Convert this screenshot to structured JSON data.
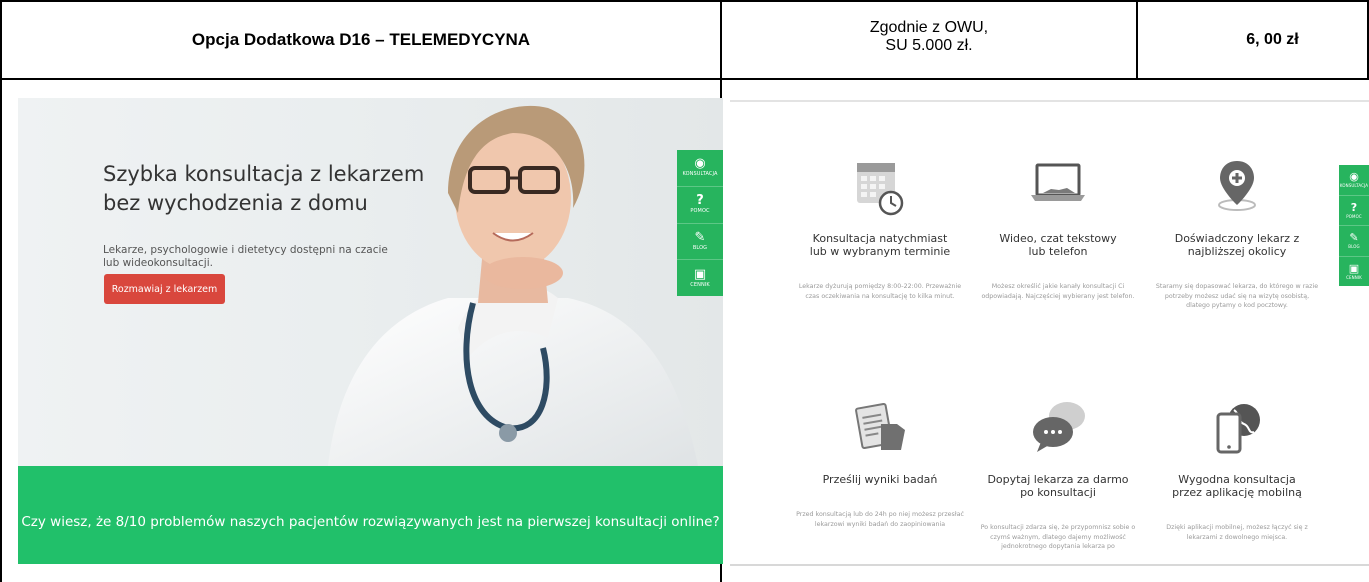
{
  "header": {
    "title": "Opcja Dodatkowa D16 – TELEMEDYCYNA",
    "terms_line1": "Zgodnie z OWU,",
    "terms_line2": "SU 5.000 zł.",
    "price": "6, 00 zł"
  },
  "left_screenshot": {
    "hero_title_line1": "Szybka konsultacja z lekarzem",
    "hero_title_line2": "bez wychodzenia z domu",
    "hero_subtitle_line1": "Lekarze, psychologowie i dietetycy dostępni na czacie",
    "hero_subtitle_line2": "lub wideokonsultacji.",
    "cta_button": "Rozmawiaj z lekarzem",
    "banner_text": "Czy wiesz, że 8/10 problemów naszych pacjentów rozwiązywanych jest na pierwszej konsultacji online?",
    "accent_color": "#21c06a",
    "button_color": "#d9473d"
  },
  "sidebar": {
    "items": [
      {
        "icon": "speech-bubble-icon",
        "label": "KONSULTACJA"
      },
      {
        "icon": "question-mark-icon",
        "label": "POMOC"
      },
      {
        "icon": "edit-icon",
        "label": "BLOG"
      },
      {
        "icon": "money-icon",
        "label": "CENNIK"
      }
    ]
  },
  "right_screenshot": {
    "features": [
      {
        "icon": "calendar-clock-icon",
        "title_line1": "Konsultacja natychmiast",
        "title_line2": "lub w wybranym terminie",
        "desc": "Lekarze dyżurują pomiędzy 8:00-22:00. Przeważnie czas oczekiwania na konsultację to kilka minut."
      },
      {
        "icon": "laptop-icon",
        "title_line1": "Wideo, czat tekstowy",
        "title_line2": "lub telefon",
        "desc": "Możesz określić jakie kanały konsultacji Ci odpowiadają. Najczęściej wybierany jest telefon."
      },
      {
        "icon": "location-pin-icon",
        "title_line1": "Doświadczony lekarz z",
        "title_line2": "najbliższej okolicy",
        "desc": "Staramy się dopasować lekarza, do którego w razie potrzeby możesz udać się na wizytę osobistą, dlatego pytamy o kod pocztowy."
      },
      {
        "icon": "clipboard-folder-icon",
        "title_line1": "Prześlij wyniki badań",
        "title_line2": "",
        "desc": "Przed konsultacją lub do 24h po niej możesz przesłać lekarzowi wyniki badań do zaopiniowania"
      },
      {
        "icon": "chat-bubbles-icon",
        "title_line1": "Dopytaj lekarza za darmo",
        "title_line2": "po konsultacji",
        "desc": "Po konsultacji zdarza się, że przypomnisz sobie o czymś ważnym, dlatego dajemy możliwość jednokrotnego dopytania lekarza po"
      },
      {
        "icon": "phone-globe-icon",
        "title_line1": "Wygodna konsultacja",
        "title_line2": "przez aplikację mobilną",
        "desc": "Dzięki aplikacji mobilnej, możesz łączyć się z lekarzami z dowolnego miejsca."
      }
    ]
  }
}
